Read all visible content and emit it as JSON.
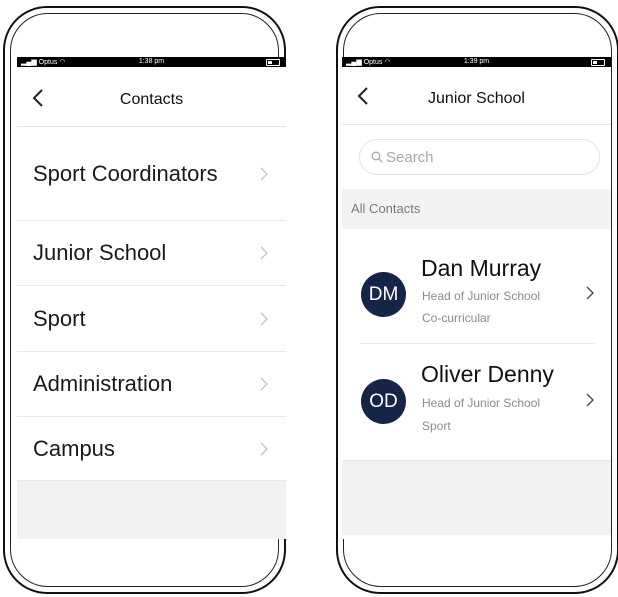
{
  "left_screen": {
    "status_bar": {
      "carrier": "Optus",
      "time": "1:38 pm"
    },
    "nav": {
      "title": "Contacts"
    },
    "categories": [
      {
        "label": "Sport Coordinators"
      },
      {
        "label": "Junior School"
      },
      {
        "label": "Sport"
      },
      {
        "label": "Administration"
      },
      {
        "label": "Campus"
      }
    ]
  },
  "right_screen": {
    "status_bar": {
      "carrier": "Optus",
      "time": "1:39 pm"
    },
    "nav": {
      "title": "Junior School"
    },
    "search": {
      "placeholder": "Search"
    },
    "section_header": "All Contacts",
    "contacts": [
      {
        "initials": "DM",
        "name": "Dan Murray",
        "role": "Head of Junior School",
        "department": "Co-curricular"
      },
      {
        "initials": "OD",
        "name": "Oliver Denny",
        "role": "Head of Junior School",
        "department": "Sport"
      }
    ]
  },
  "colors": {
    "avatar_bg": "#162447",
    "status_bar_bg": "#000000",
    "section_bg": "#f2f2f4"
  },
  "icons": {
    "back": "chevron-left-icon",
    "row": "chevron-right-icon",
    "search": "search-icon",
    "wifi": "wifi-icon",
    "battery": "battery-icon"
  }
}
